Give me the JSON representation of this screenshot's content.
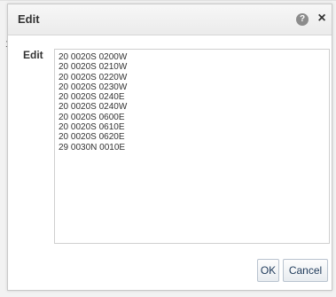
{
  "dialog": {
    "title": "Edit",
    "help_icon": "help-icon",
    "help_glyph": "?",
    "close_icon": "close-icon",
    "close_glyph": "×"
  },
  "backdrop": {
    "mark": "1"
  },
  "form": {
    "edit_label": "Edit",
    "edit_value": "20 0020S 0200W\n20 0020S 0210W\n20 0020S 0220W\n20 0020S 0230W\n20 0020S 0240E\n20 0020S 0240W\n20 0020S 0600E\n20 0020S 0610E\n20 0020S 0620E\n29 0030N 0010E"
  },
  "buttons": {
    "ok_label": "OK",
    "cancel_label": "Cancel"
  },
  "colors": {
    "button_text": "#1f3a5a",
    "title_text": "#333333"
  }
}
